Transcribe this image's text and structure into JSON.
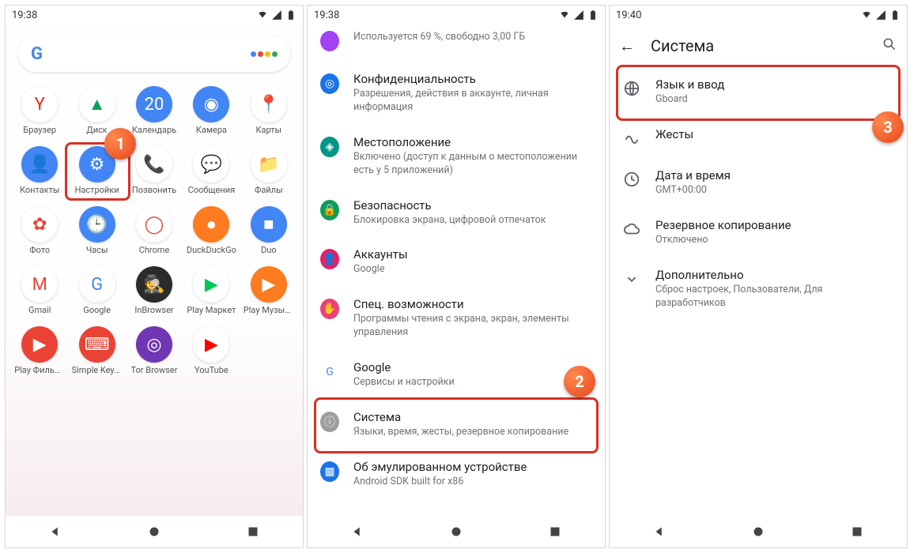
{
  "colors": {
    "accent_red": "#d93025"
  },
  "screen1": {
    "time": "19:38",
    "apps": [
      {
        "label": "Браузер",
        "glyph": "Y",
        "bg": "b-white",
        "fg": "#e52620"
      },
      {
        "label": "Диск",
        "glyph": "▲",
        "bg": "b-white",
        "fg": "#0f9d58"
      },
      {
        "label": "Календарь",
        "glyph": "20",
        "bg": "b-blue"
      },
      {
        "label": "Камера",
        "glyph": "◉",
        "bg": "b-blue"
      },
      {
        "label": "Карты",
        "glyph": "📍",
        "bg": "b-white",
        "fg": "#34a853"
      },
      {
        "label": "Контакты",
        "glyph": "👤",
        "bg": "b-blue"
      },
      {
        "label": "Настройки",
        "glyph": "⚙",
        "bg": "b-blue",
        "highlight": true
      },
      {
        "label": "Позвонить",
        "glyph": "📞",
        "bg": "b-white",
        "fg": "#1a73e8"
      },
      {
        "label": "Сообщения",
        "glyph": "💬",
        "bg": "b-white",
        "fg": "#1a73e8"
      },
      {
        "label": "Файлы",
        "glyph": "📁",
        "bg": "b-white",
        "fg": "#1a73e8"
      },
      {
        "label": "Фото",
        "glyph": "✿",
        "bg": "b-white",
        "fg": "#ea4335"
      },
      {
        "label": "Часы",
        "glyph": "🕒",
        "bg": "b-blue"
      },
      {
        "label": "Chrome",
        "glyph": "◯",
        "bg": "b-white",
        "fg": "#ea4335"
      },
      {
        "label": "DuckDuckGo",
        "glyph": "●",
        "bg": "b-orange"
      },
      {
        "label": "Duo",
        "glyph": "■",
        "bg": "b-blue"
      },
      {
        "label": "Gmail",
        "glyph": "M",
        "bg": "b-white",
        "fg": "#ea4335"
      },
      {
        "label": "Google",
        "glyph": "G",
        "bg": "b-white",
        "fg": "#4285F4"
      },
      {
        "label": "InBrowser",
        "glyph": "🕵",
        "bg": "b-dark"
      },
      {
        "label": "Play Маркет",
        "glyph": "▶",
        "bg": "b-white",
        "fg": "#00c853"
      },
      {
        "label": "Play Музыка",
        "glyph": "▶",
        "bg": "b-orange"
      },
      {
        "label": "Play Фильмы",
        "glyph": "▶",
        "bg": "b-red"
      },
      {
        "label": "Simple Keyboard",
        "glyph": "⌨",
        "bg": "b-red"
      },
      {
        "label": "Tor Browser",
        "glyph": "◎",
        "bg": "b-purple"
      },
      {
        "label": "YouTube",
        "glyph": "▶",
        "bg": "b-white",
        "fg": "#ff0000"
      }
    ],
    "bubble": "1"
  },
  "screen2": {
    "time": "19:38",
    "items": [
      {
        "icon_bg": "#a142f4",
        "title": "",
        "subtitle": "Используется 69 %, свободно 3,00 ГБ"
      },
      {
        "icon_bg": "#1a73e8",
        "glyph": "◎",
        "title": "Конфиденциальность",
        "subtitle": "Разрешения, действия в аккаунте, личная информация"
      },
      {
        "icon_bg": "#009688",
        "glyph": "◈",
        "title": "Местоположение",
        "subtitle": "Включено (доступ к данным о местоположении есть у 5 приложений)"
      },
      {
        "icon_bg": "#0f9d58",
        "glyph": "🔒",
        "title": "Безопасность",
        "subtitle": "Блокировка экрана, цифровой отпечаток"
      },
      {
        "icon_bg": "#e91e63",
        "glyph": "👤",
        "title": "Аккаунты",
        "subtitle": "Google"
      },
      {
        "icon_bg": "#ec407a",
        "glyph": "✋",
        "title": "Спец. возможности",
        "subtitle": "Программы чтения с экрана, экран, элементы управления"
      },
      {
        "icon_bg": "#ffffff",
        "glyph": "G",
        "fg": "#4285F4",
        "title": "Google",
        "subtitle": "Сервисы и настройки"
      },
      {
        "icon_bg": "#9e9e9e",
        "glyph": "ⓘ",
        "title": "Система",
        "subtitle": "Языки, время, жесты, резервное копирование",
        "highlight": true
      },
      {
        "icon_bg": "#1a73e8",
        "glyph": "▦",
        "title": "Об эмулированном устройстве",
        "subtitle": "Android SDK built for x86"
      }
    ],
    "bubble": "2"
  },
  "screen3": {
    "time": "19:40",
    "appbar_title": "Система",
    "items": [
      {
        "icon": "globe",
        "title": "Язык и ввод",
        "subtitle": "Gboard",
        "highlight": true
      },
      {
        "icon": "gesture",
        "title": "Жесты",
        "subtitle": ""
      },
      {
        "icon": "clock",
        "title": "Дата и время",
        "subtitle": "GMT+00:00"
      },
      {
        "icon": "cloud",
        "title": "Резервное копирование",
        "subtitle": "Отключено"
      },
      {
        "icon": "chevron",
        "title": "Дополнительно",
        "subtitle": "Сброс настроек, Пользователи, Для разработчиков"
      }
    ],
    "bubble": "3"
  }
}
